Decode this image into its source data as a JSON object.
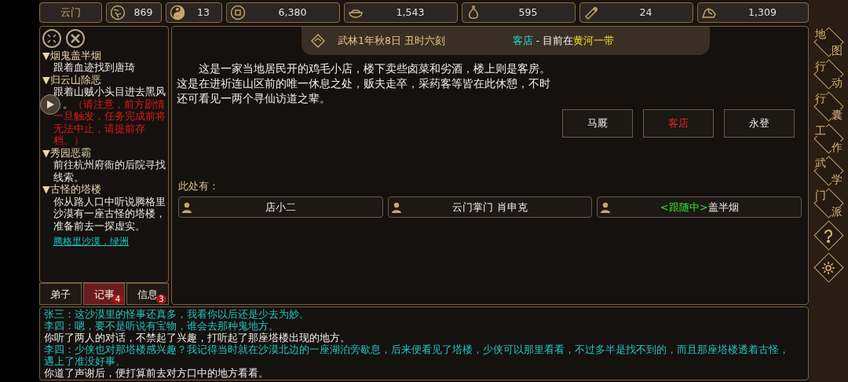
{
  "top_bar": {
    "sect": "云门",
    "stats": [
      {
        "kind": "reputation",
        "value": "869"
      },
      {
        "kind": "yinyang",
        "value": "13"
      },
      {
        "kind": "coin",
        "value": "6,380"
      },
      {
        "kind": "food",
        "value": "1,543"
      },
      {
        "kind": "gourd",
        "value": "595"
      },
      {
        "kind": "wood",
        "value": "24"
      },
      {
        "kind": "ore",
        "value": "1,309"
      }
    ]
  },
  "quest_panel": {
    "quests": [
      {
        "title": "▼烟鬼盖半烟",
        "desc": "跟着血迹找到唐琦"
      },
      {
        "title": "▼归云山除恶",
        "desc": "跟着山贼小头目进去黑风",
        "tail": "。",
        "warning": "（请注意，前方剧情",
        "warning_rest": "一旦触发，任务完成前将无法中止，请提前存档。）"
      },
      {
        "title": "▼秀园恶霸",
        "desc": "前往杭州府衙的后院寻找线索。"
      },
      {
        "title": "▼古怪的塔楼",
        "desc": "你从路人口中听说腾格里沙漠有一座古怪的塔楼，准备前去一探虚实。",
        "link": "腾格里沙漠，绿洲"
      }
    ],
    "tabs": [
      {
        "label": "弟子",
        "selected": false
      },
      {
        "label": "记事",
        "selected": true,
        "badge": "4"
      },
      {
        "label": "信息",
        "selected": false,
        "badge": "3"
      }
    ]
  },
  "scene": {
    "date": "武林1年秋8日 丑时六刻",
    "location": "客店",
    "region_prefix": " - 目前在",
    "region": "黄河一带",
    "description": "这是一家当地居民开的鸡毛小店，楼下卖些卤菜和劣酒，楼上则是客房。这是在进祈连山区前的唯一休息之处，贩夫走卒，采药客等皆在此休憩，不时还可看见一两个寻仙访道之辈。",
    "exits": [
      {
        "label": "马厩",
        "selected": false
      },
      {
        "label": "客店",
        "selected": true
      },
      {
        "label": "永登",
        "selected": false
      }
    ],
    "here_label": "此处有：",
    "npcs": [
      {
        "name": "店小二"
      },
      {
        "name": "云门掌门 肖申克"
      },
      {
        "tag": "<跟随中>",
        "name": "盖半烟"
      }
    ]
  },
  "log": [
    {
      "kind": "speech",
      "text": "张三：这沙漠里的怪事还真多，我看你以后还是少去为妙。"
    },
    {
      "kind": "speech",
      "text": "李四：嗯，要不是听说有宝物，谁会去那种鬼地方。"
    },
    {
      "kind": "narration",
      "text": "你听了两人的对话，不禁起了兴趣，打听起了那座塔楼出现的地方。"
    },
    {
      "kind": "speech",
      "text": "李四：少侠也对那塔楼感兴趣？我记得当时就在沙漠北边的一座湖泊旁歇息，后来便看见了塔楼，少侠可以那里看看，不过多半是找不到的，而且那座塔楼透着古怪，遇上了准没好事。"
    },
    {
      "kind": "narration",
      "text": "你道了声谢后，便打算前去对方口中的地方看看。"
    }
  ],
  "side_menu": [
    {
      "kind": "text",
      "chars": [
        "地",
        "图"
      ]
    },
    {
      "kind": "text",
      "chars": [
        "行",
        "动"
      ]
    },
    {
      "kind": "text",
      "chars": [
        "行",
        "囊"
      ]
    },
    {
      "kind": "text",
      "chars": [
        "工",
        "作"
      ]
    },
    {
      "kind": "text",
      "chars": [
        "武",
        "学"
      ]
    },
    {
      "kind": "text",
      "chars": [
        "门",
        "派"
      ]
    },
    {
      "kind": "help"
    },
    {
      "kind": "settings"
    }
  ]
}
